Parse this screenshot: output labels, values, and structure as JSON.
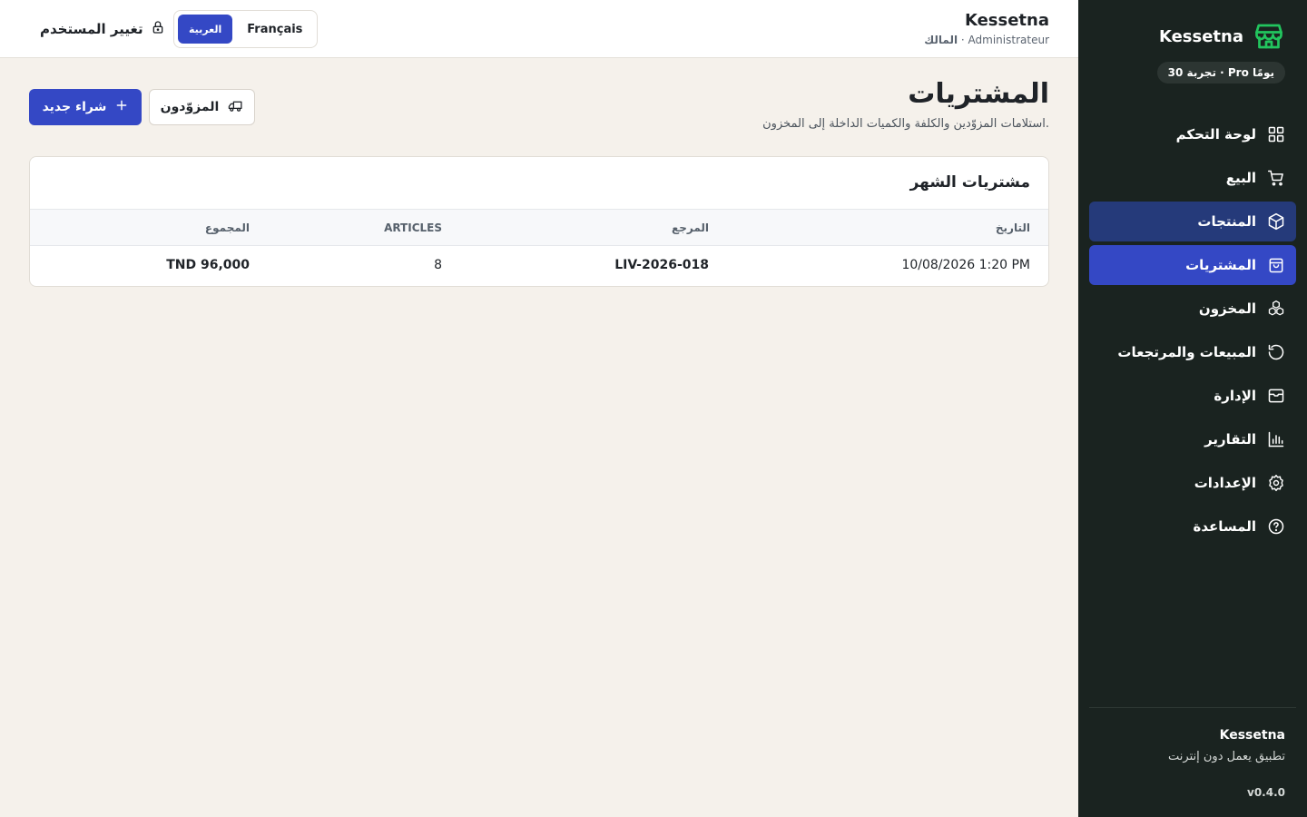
{
  "sidebar": {
    "brand": "Kessetna",
    "trial": "تجربة 30 · Pro يومًا",
    "items": [
      {
        "label": "لوحة التحكم",
        "icon": "dashboard-icon"
      },
      {
        "label": "البيع",
        "icon": "cart-icon"
      },
      {
        "label": "المنتجات",
        "icon": "box-icon"
      },
      {
        "label": "المشتريات",
        "icon": "shopping-bag-icon"
      },
      {
        "label": "المخزون",
        "icon": "boxes-icon"
      },
      {
        "label": "المبيعات والمرتجعات",
        "icon": "history-icon"
      },
      {
        "label": "الإدارة",
        "icon": "archive-icon"
      },
      {
        "label": "التقارير",
        "icon": "bar-chart-icon"
      },
      {
        "label": "الإعدادات",
        "icon": "gear-icon"
      },
      {
        "label": "المساعدة",
        "icon": "help-icon"
      }
    ],
    "footer": {
      "name": "Kessetna",
      "subtitle": "تطبيق يعمل دون إنترنت",
      "version": "v0.4.0"
    }
  },
  "topbar": {
    "org_name": "Kessetna",
    "role_fr": "Administrateur",
    "role_ar": "المالك",
    "lang": {
      "fr": "Français",
      "ar": "العربية",
      "active": "ar"
    },
    "switch_user": "تغيير المستخدم"
  },
  "page": {
    "title": "المشتريات",
    "subtitle": "استلامات المزوّدين والكلفة والكميات الداخلة إلى المخزون.",
    "new_purchase": "شراء جديد",
    "suppliers": "المزوّدون"
  },
  "card": {
    "title": "مشتريات الشهر",
    "columns": {
      "date": "التاريخ",
      "reference": "المرجع",
      "articles": "ARTICLES",
      "total": "المجموع"
    },
    "rows": [
      {
        "date": "10/08/2026 1:20 PM",
        "reference": "LIV-2026-018",
        "articles": "8",
        "total": "TND 96,000"
      }
    ]
  },
  "colors": {
    "sidebar_bg": "#1a2320",
    "accent": "#3448c5",
    "accent_dim": "#253a7a",
    "page_bg": "#f5f1eb",
    "logo": "#22c55e"
  }
}
